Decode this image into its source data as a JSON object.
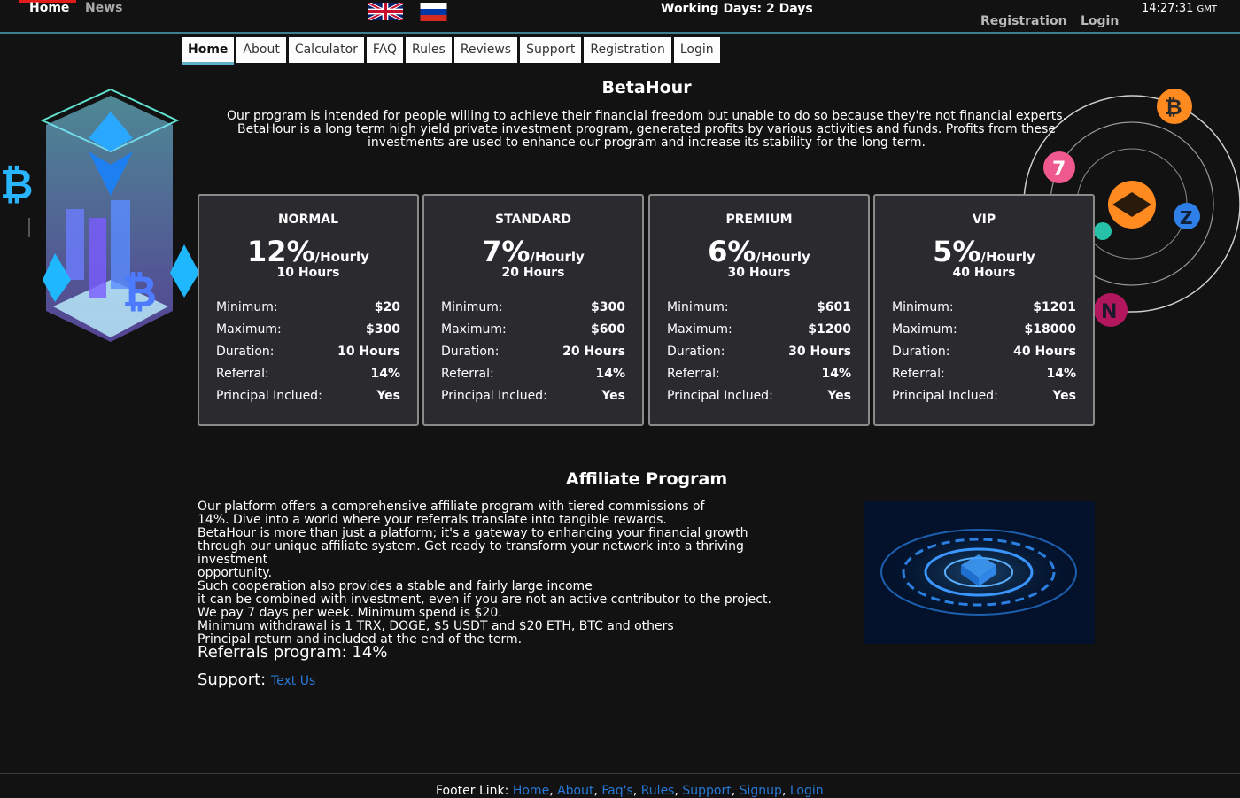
{
  "topbar": {
    "home": "Home",
    "news": "News",
    "working_days": "Working Days: 2 Days",
    "registration": "Registration",
    "login": "Login",
    "time": "14:27:31",
    "tz": "GMT",
    "flags": [
      "uk-flag-icon",
      "russia-flag-icon"
    ]
  },
  "nav": {
    "items": [
      "Home",
      "About",
      "Calculator",
      "FAQ",
      "Rules",
      "Reviews",
      "Support",
      "Registration",
      "Login"
    ],
    "active": "Home"
  },
  "hero": {
    "title": "BetaHour",
    "intro": "Our program is intended for people willing to achieve their financial freedom but unable to do so because they're not financial experts. BetaHour is a long term high yield private investment program, generated profits by various activities and funds. Profits from these investments are used to enhance our program and increase its stability for the long term."
  },
  "row_labels": {
    "minimum": "Minimum:",
    "maximum": "Maximum:",
    "duration": "Duration:",
    "referral": "Referral:",
    "principal": "Principal Inclued:"
  },
  "plans": [
    {
      "name": "NORMAL",
      "rate": "12%",
      "per": "/Hourly",
      "hours": "10 Hours",
      "minimum": "$20",
      "maximum": "$300",
      "duration": "10 Hours",
      "referral": "14%",
      "principal": "Yes"
    },
    {
      "name": "STANDARD",
      "rate": "7%",
      "per": "/Hourly",
      "hours": "20 Hours",
      "minimum": "$300",
      "maximum": "$600",
      "duration": "20 Hours",
      "referral": "14%",
      "principal": "Yes"
    },
    {
      "name": "PREMIUM",
      "rate": "6%",
      "per": "/Hourly",
      "hours": "30 Hours",
      "minimum": "$601",
      "maximum": "$1200",
      "duration": "30 Hours",
      "referral": "14%",
      "principal": "Yes"
    },
    {
      "name": "VIP",
      "rate": "5%",
      "per": "/Hourly",
      "hours": "40 Hours",
      "minimum": "$1201",
      "maximum": "$18000",
      "duration": "40 Hours",
      "referral": "14%",
      "principal": "Yes"
    }
  ],
  "affiliate": {
    "title": "Affiliate Program",
    "paragraphs": [
      "Our platform offers a comprehensive affiliate program with tiered commissions of",
      "14%. Dive into a world where your referrals translate into tangible rewards.",
      "BetaHour is more than just a platform; it's a gateway to enhancing your financial growth",
      "through our unique affiliate system. Get ready to transform your network into a thriving investment",
      "opportunity.",
      "Such cooperation also provides a stable and fairly large income",
      "it can be combined with investment, even if you are not an active contributor to the project.",
      "We pay 7 days per week. Minimum spend is $20.",
      "Minimum withdrawal is 1 TRX, DOGE, $5 USDT and $20 ETH, BTC and others",
      "Principal return and included at the end of the term."
    ],
    "referrals": "Referrals program: 14%",
    "support_label": "Support:",
    "support_link": "Text Us"
  },
  "footer": {
    "label": "Footer Link:",
    "links": [
      "Home",
      "About",
      "Faq's",
      "Rules",
      "Support",
      "Signup",
      "Login"
    ]
  },
  "colors": {
    "background": "#121212",
    "card": "#2b2a2e",
    "link": "#2979d6",
    "accent_red": "#e31b1b",
    "nav_underline": "#5fb3c9"
  }
}
